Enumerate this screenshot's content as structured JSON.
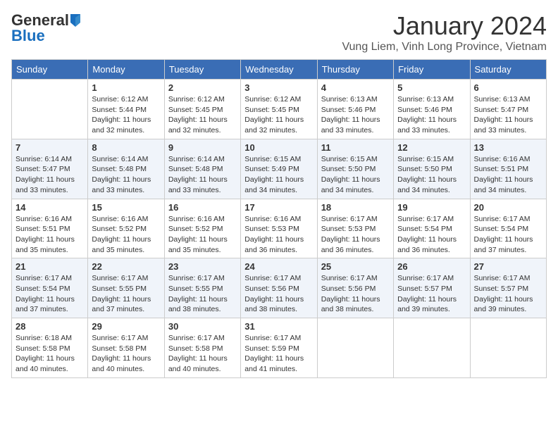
{
  "header": {
    "logo_general": "General",
    "logo_blue": "Blue",
    "month_title": "January 2024",
    "location": "Vung Liem, Vinh Long Province, Vietnam"
  },
  "days_of_week": [
    "Sunday",
    "Monday",
    "Tuesday",
    "Wednesday",
    "Thursday",
    "Friday",
    "Saturday"
  ],
  "weeks": [
    [
      {
        "day": "",
        "info": ""
      },
      {
        "day": "1",
        "info": "Sunrise: 6:12 AM\nSunset: 5:44 PM\nDaylight: 11 hours\nand 32 minutes."
      },
      {
        "day": "2",
        "info": "Sunrise: 6:12 AM\nSunset: 5:45 PM\nDaylight: 11 hours\nand 32 minutes."
      },
      {
        "day": "3",
        "info": "Sunrise: 6:12 AM\nSunset: 5:45 PM\nDaylight: 11 hours\nand 32 minutes."
      },
      {
        "day": "4",
        "info": "Sunrise: 6:13 AM\nSunset: 5:46 PM\nDaylight: 11 hours\nand 33 minutes."
      },
      {
        "day": "5",
        "info": "Sunrise: 6:13 AM\nSunset: 5:46 PM\nDaylight: 11 hours\nand 33 minutes."
      },
      {
        "day": "6",
        "info": "Sunrise: 6:13 AM\nSunset: 5:47 PM\nDaylight: 11 hours\nand 33 minutes."
      }
    ],
    [
      {
        "day": "7",
        "info": "Sunrise: 6:14 AM\nSunset: 5:47 PM\nDaylight: 11 hours\nand 33 minutes."
      },
      {
        "day": "8",
        "info": "Sunrise: 6:14 AM\nSunset: 5:48 PM\nDaylight: 11 hours\nand 33 minutes."
      },
      {
        "day": "9",
        "info": "Sunrise: 6:14 AM\nSunset: 5:48 PM\nDaylight: 11 hours\nand 33 minutes."
      },
      {
        "day": "10",
        "info": "Sunrise: 6:15 AM\nSunset: 5:49 PM\nDaylight: 11 hours\nand 34 minutes."
      },
      {
        "day": "11",
        "info": "Sunrise: 6:15 AM\nSunset: 5:50 PM\nDaylight: 11 hours\nand 34 minutes."
      },
      {
        "day": "12",
        "info": "Sunrise: 6:15 AM\nSunset: 5:50 PM\nDaylight: 11 hours\nand 34 minutes."
      },
      {
        "day": "13",
        "info": "Sunrise: 6:16 AM\nSunset: 5:51 PM\nDaylight: 11 hours\nand 34 minutes."
      }
    ],
    [
      {
        "day": "14",
        "info": "Sunrise: 6:16 AM\nSunset: 5:51 PM\nDaylight: 11 hours\nand 35 minutes."
      },
      {
        "day": "15",
        "info": "Sunrise: 6:16 AM\nSunset: 5:52 PM\nDaylight: 11 hours\nand 35 minutes."
      },
      {
        "day": "16",
        "info": "Sunrise: 6:16 AM\nSunset: 5:52 PM\nDaylight: 11 hours\nand 35 minutes."
      },
      {
        "day": "17",
        "info": "Sunrise: 6:16 AM\nSunset: 5:53 PM\nDaylight: 11 hours\nand 36 minutes."
      },
      {
        "day": "18",
        "info": "Sunrise: 6:17 AM\nSunset: 5:53 PM\nDaylight: 11 hours\nand 36 minutes."
      },
      {
        "day": "19",
        "info": "Sunrise: 6:17 AM\nSunset: 5:54 PM\nDaylight: 11 hours\nand 36 minutes."
      },
      {
        "day": "20",
        "info": "Sunrise: 6:17 AM\nSunset: 5:54 PM\nDaylight: 11 hours\nand 37 minutes."
      }
    ],
    [
      {
        "day": "21",
        "info": "Sunrise: 6:17 AM\nSunset: 5:54 PM\nDaylight: 11 hours\nand 37 minutes."
      },
      {
        "day": "22",
        "info": "Sunrise: 6:17 AM\nSunset: 5:55 PM\nDaylight: 11 hours\nand 37 minutes."
      },
      {
        "day": "23",
        "info": "Sunrise: 6:17 AM\nSunset: 5:55 PM\nDaylight: 11 hours\nand 38 minutes."
      },
      {
        "day": "24",
        "info": "Sunrise: 6:17 AM\nSunset: 5:56 PM\nDaylight: 11 hours\nand 38 minutes."
      },
      {
        "day": "25",
        "info": "Sunrise: 6:17 AM\nSunset: 5:56 PM\nDaylight: 11 hours\nand 38 minutes."
      },
      {
        "day": "26",
        "info": "Sunrise: 6:17 AM\nSunset: 5:57 PM\nDaylight: 11 hours\nand 39 minutes."
      },
      {
        "day": "27",
        "info": "Sunrise: 6:17 AM\nSunset: 5:57 PM\nDaylight: 11 hours\nand 39 minutes."
      }
    ],
    [
      {
        "day": "28",
        "info": "Sunrise: 6:18 AM\nSunset: 5:58 PM\nDaylight: 11 hours\nand 40 minutes."
      },
      {
        "day": "29",
        "info": "Sunrise: 6:17 AM\nSunset: 5:58 PM\nDaylight: 11 hours\nand 40 minutes."
      },
      {
        "day": "30",
        "info": "Sunrise: 6:17 AM\nSunset: 5:58 PM\nDaylight: 11 hours\nand 40 minutes."
      },
      {
        "day": "31",
        "info": "Sunrise: 6:17 AM\nSunset: 5:59 PM\nDaylight: 11 hours\nand 41 minutes."
      },
      {
        "day": "",
        "info": ""
      },
      {
        "day": "",
        "info": ""
      },
      {
        "day": "",
        "info": ""
      }
    ]
  ]
}
